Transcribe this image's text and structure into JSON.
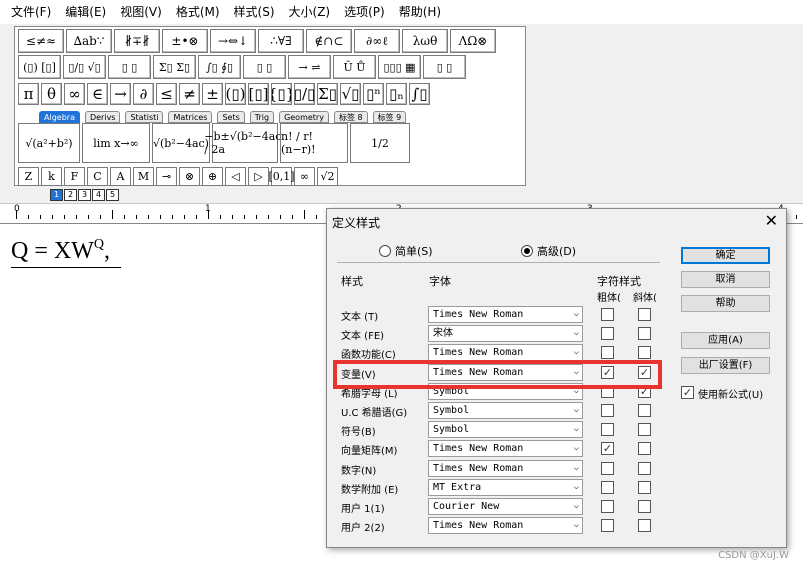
{
  "menu": [
    "文件(F)",
    "编辑(E)",
    "视图(V)",
    "格式(M)",
    "样式(S)",
    "大小(Z)",
    "选项(P)",
    "帮助(H)"
  ],
  "toolbar": {
    "row1": [
      "≤≠≈",
      "∆ab∵",
      "∦∓∦",
      "±•⊗",
      "→⇔↓",
      "∴∀∃",
      "∉∩⊂",
      "∂∞ℓ",
      "λωθ",
      "ΛΩ⊗"
    ],
    "row2": [
      "(▯) [▯]",
      "▯/▯ √▯",
      "▯ ▯",
      "Σ▯ Σ▯",
      "∫▯ ∮▯",
      "▯ ▯",
      "→ ⇌",
      "Ū Ů",
      "▯▯▯ ▦",
      "▯ ▯"
    ],
    "row3": [
      "π",
      "θ",
      "∞",
      "∈",
      "→",
      "∂",
      "≤",
      "≠",
      "±",
      "(▯)",
      "[▯]",
      "{▯}",
      "▯/▯",
      "Σ▯",
      "√▯",
      "▯ⁿ",
      "▯ₙ",
      "∫▯"
    ],
    "tabs": [
      "Algebra",
      "Derivs",
      "Statisti",
      "Matrices",
      "Sets",
      "Trig",
      "Geometry",
      "标签 8",
      "标签 9"
    ],
    "templates": [
      "√(a²+b²)",
      "lim x→∞",
      "√(b²−4ac)",
      "−b±√(b²−4ac) / 2a",
      "n! / r!(n−r)!",
      "1/2"
    ],
    "small": [
      "Z",
      "k",
      "F",
      "C",
      "A",
      "M",
      "⊸",
      "⊗",
      "⊕",
      "◁",
      "▷",
      "[0,1]",
      "∞",
      "√2"
    ],
    "size_buttons": [
      "1",
      "2",
      "3",
      "4",
      "5"
    ]
  },
  "ruler": {
    "labels": [
      "0",
      "1",
      "2",
      "3",
      "4"
    ]
  },
  "equation": {
    "lhs": "Q = XW",
    "sup": "Q",
    "tail": ","
  },
  "dialog": {
    "title": "定义样式",
    "close": "✕",
    "radio_simple": "简单(S)",
    "radio_advanced": "高级(D)",
    "hdr_style": "样式",
    "hdr_font": "字体",
    "hdr_charstyle": "字符样式",
    "hdr_bold": "粗体(B)",
    "hdr_italic": "斜体(I)",
    "rows": [
      {
        "label": "文本 (T)",
        "font": "Times New Roman",
        "bold": false,
        "italic": false
      },
      {
        "label": "文本 (FE)",
        "font": "宋体",
        "bold": false,
        "italic": false
      },
      {
        "label": "函数功能(C)",
        "font": "Times New Roman",
        "bold": false,
        "italic": false
      },
      {
        "label": "变量(V)",
        "font": "Times New Roman",
        "bold": true,
        "italic": true
      },
      {
        "label": "希腊字母 (L)",
        "font": "Symbol",
        "bold": false,
        "italic": true
      },
      {
        "label": "U.C 希腊语(G)",
        "font": "Symbol",
        "bold": false,
        "italic": false
      },
      {
        "label": "符号(B)",
        "font": "Symbol",
        "bold": false,
        "italic": false
      },
      {
        "label": "向量矩阵(M)",
        "font": "Times New Roman",
        "bold": true,
        "italic": false
      },
      {
        "label": "数字(N)",
        "font": "Times New Roman",
        "bold": false,
        "italic": false
      },
      {
        "label": "数学附加 (E)",
        "font": "MT Extra",
        "bold": false,
        "italic": false
      },
      {
        "label": "用户 1(1)",
        "font": "Courier New",
        "bold": false,
        "italic": false
      },
      {
        "label": "用户 2(2)",
        "font": "Times New Roman",
        "bold": false,
        "italic": false
      }
    ],
    "buttons": {
      "ok": "确定",
      "cancel": "取消",
      "help": "帮助",
      "apply": "应用(A)",
      "factory": "出厂设置(F)"
    },
    "use_new": "使用新公式(U)"
  },
  "watermark": "CSDN @XuJ.W",
  "colors": {
    "highlight": "#e8332e",
    "accent": "#1f73d9"
  }
}
